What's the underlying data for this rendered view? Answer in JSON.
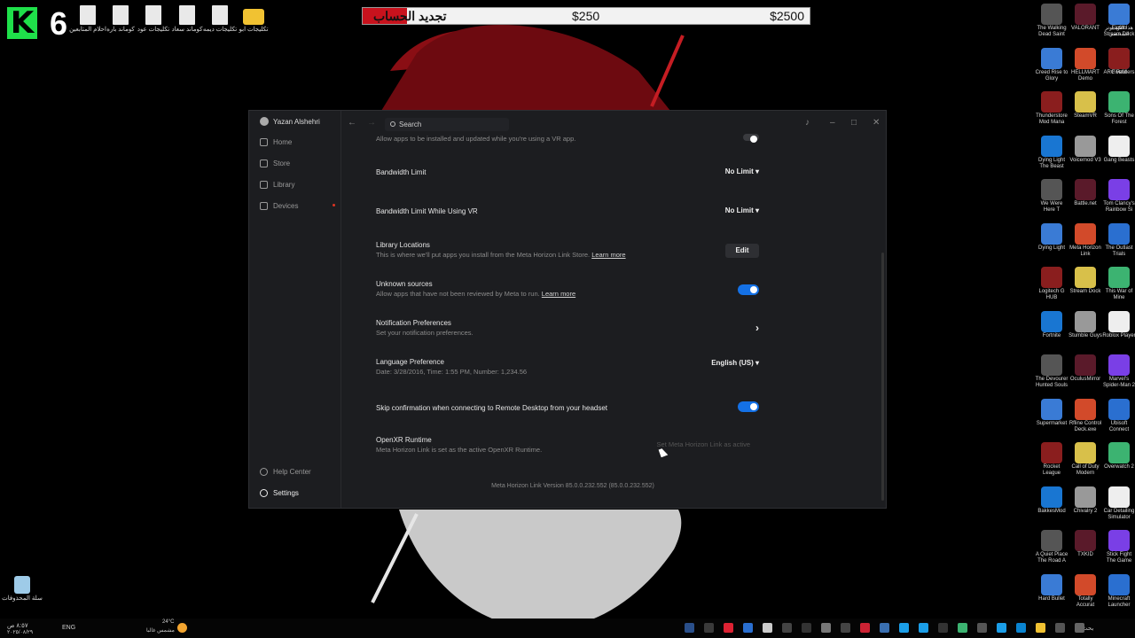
{
  "overlay": {
    "label": "تجديد الحساب",
    "amount_1": "$250",
    "amount_2": "$2500"
  },
  "stream_badge": {
    "logo_letter": "K",
    "number": "6"
  },
  "desktop_files": [
    {
      "label": "احلام المتابعين",
      "type": "file"
    },
    {
      "label": "كوماند باره",
      "type": "file"
    },
    {
      "label": "تكليجات عود",
      "type": "file"
    },
    {
      "label": "كوماند سعاد",
      "type": "file"
    },
    {
      "label": "تكليجات ديمه",
      "type": "file"
    },
    {
      "label": "تكليجات ابو",
      "type": "folder"
    }
  ],
  "recycle_bin": {
    "label": "سلة المحذوفات"
  },
  "window": {
    "user_name": "Yazan Alshehri",
    "nav": [
      "Home",
      "Store",
      "Library",
      "Devices"
    ],
    "help_label": "Help Center",
    "settings_label": "Settings",
    "search_placeholder": "Search",
    "top_hint": "Allow apps to be installed and updated while you're using a VR app.",
    "rows": {
      "bandwidth": {
        "title": "Bandwidth Limit",
        "value": "No Limit ▾"
      },
      "bandwidth_vr": {
        "title": "Bandwidth Limit While Using VR",
        "value": "No Limit ▾"
      },
      "library_locations": {
        "title": "Library Locations",
        "sub": "This is where we'll put apps you install from the Meta Horizon Link Store.",
        "link": "Learn more",
        "button": "Edit"
      },
      "unknown_sources": {
        "title": "Unknown sources",
        "sub": "Allow apps that have not been reviewed by Meta to run.",
        "link": "Learn more"
      },
      "notifications": {
        "title": "Notification Preferences",
        "sub": "Set your notification preferences.",
        "arrow": "›"
      },
      "language": {
        "title": "Language Preference",
        "sub": "Date: 3/28/2016, Time: 1:55 PM, Number: 1,234.56",
        "value": "English (US) ▾"
      },
      "skip_confirm": {
        "title": "Skip confirmation when connecting to Remote Desktop from your headset"
      },
      "openxr": {
        "title": "OpenXR Runtime",
        "sub": "Meta Horizon Link is set as the active OpenXR Runtime.",
        "button": "Set Meta Horizon Link as active"
      }
    },
    "version": "Meta Horizon Link Version 85.0.0.232.552 (85.0.0.232.552)"
  },
  "right_icons": [
    [
      "The Walking Dead Saint",
      "VALORANT",
      "Elgato Stream Deck",
      "هذا الكمبيوتر الشخصي"
    ],
    [
      "Creed Rise to Glory",
      "HELLMART Demo",
      "ARC Raiders",
      "FiveM"
    ],
    [
      "Thunderstore Mod Mana",
      "SteamVR",
      "Sons Of The Forest",
      ""
    ],
    [
      "Dying Light The Beast",
      "Voicemod V3",
      "Gang Beasts",
      ""
    ],
    [
      "We Were Here T",
      "Battle.net",
      "Tom Clancy's Rainbow Si",
      ""
    ],
    [
      "Dying Light",
      "Meta Horizon Link",
      "The Outlast Trials",
      ""
    ],
    [
      "Logitech G HUB",
      "Stream Dock",
      "This War of Mine",
      ""
    ],
    [
      "Fortnite",
      "Stumble Guys",
      "Roblox Player",
      ""
    ],
    [
      "The Devourer Hunted Souls",
      "OculusMirror",
      "Marvel's Spider-Man 2",
      ""
    ],
    [
      "Supermarket",
      "Rfline Control Deck.exe",
      "Ubisoft Connect",
      ""
    ],
    [
      "Rocket League",
      "Call of Duty Modern",
      "Overwatch 2",
      ""
    ],
    [
      "BakkesMod",
      "Chivalry 2",
      "Car Detailing Simulator",
      ""
    ],
    [
      "A Quiet Place The Road A",
      "TXKID",
      "Stick Fight The Game",
      ""
    ],
    [
      "Hard Bullet",
      "Totally Accurat",
      "Minecraft Launcher",
      ""
    ]
  ],
  "taskbar": {
    "date": "٢٠٢٥/٠٨/٢٩",
    "time": "٨:٥٧ ص",
    "lang": "ENG",
    "weather": "24°C",
    "weather_desc": "مشمس غالبا",
    "search": "بحث"
  }
}
